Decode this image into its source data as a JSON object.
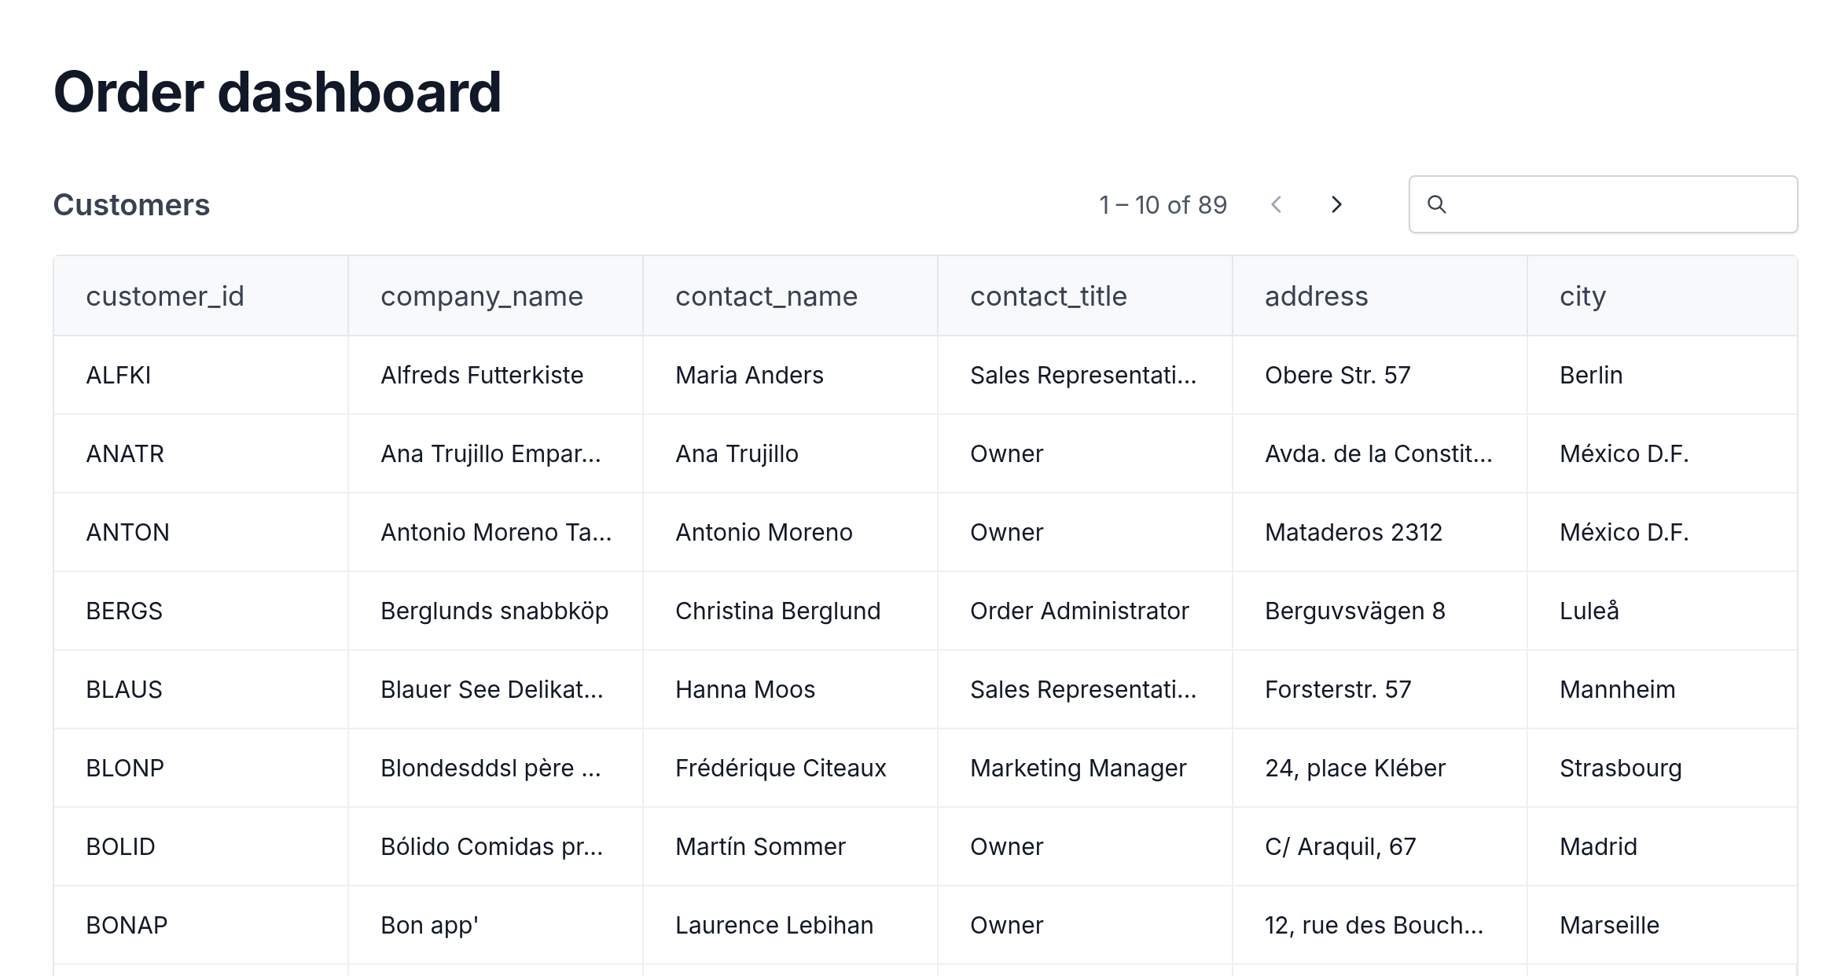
{
  "title": "Order dashboard",
  "section": {
    "title": "Customers",
    "pagination": {
      "range": "1 – 10 of 89",
      "prev_disabled": true,
      "next_disabled": false
    }
  },
  "table": {
    "columns": [
      "customer_id",
      "company_name",
      "contact_name",
      "contact_title",
      "address",
      "city"
    ],
    "rows": [
      [
        "ALFKI",
        "Alfreds Futterkiste",
        "Maria Anders",
        "Sales Representati...",
        "Obere Str. 57",
        "Berlin"
      ],
      [
        "ANATR",
        "Ana Trujillo Empar...",
        "Ana Trujillo",
        "Owner",
        "Avda. de la Constit...",
        "México D.F."
      ],
      [
        "ANTON",
        "Antonio Moreno Ta...",
        "Antonio Moreno",
        "Owner",
        "Mataderos 2312",
        "México D.F."
      ],
      [
        "BERGS",
        "Berglunds snabbköp",
        "Christina Berglund",
        "Order Administrator",
        "Berguvsvägen 8",
        "Luleå"
      ],
      [
        "BLAUS",
        "Blauer See Delikat...",
        "Hanna Moos",
        "Sales Representati...",
        "Forsterstr. 57",
        "Mannheim"
      ],
      [
        "BLONP",
        "Blondesddsl père ...",
        "Frédérique Citeaux",
        "Marketing Manager",
        "24, place Kléber",
        "Strasbourg"
      ],
      [
        "BOLID",
        "Bólido Comidas pr...",
        "Martín Sommer",
        "Owner",
        "C/ Araquil, 67",
        "Madrid"
      ],
      [
        "BONAP",
        "Bon app'",
        "Laurence Lebihan",
        "Owner",
        "12, rue des Bouch...",
        "Marseille"
      ]
    ]
  }
}
